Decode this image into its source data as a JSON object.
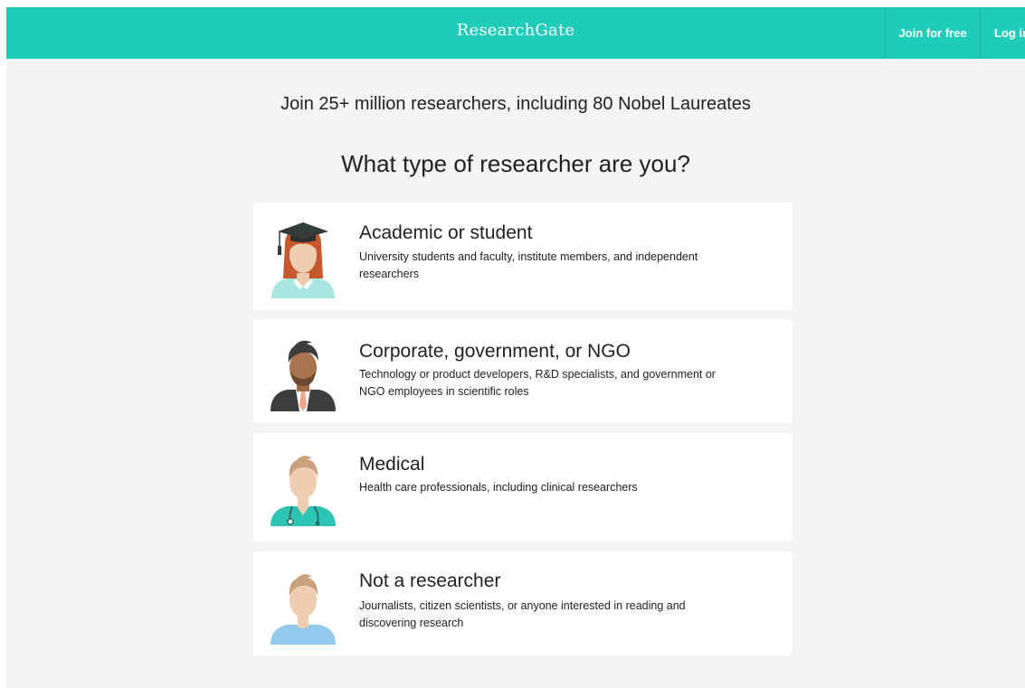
{
  "header": {
    "brand": "ResearchGate",
    "join_label": "Join for free",
    "login_label": "Log in"
  },
  "main": {
    "headline": "Join 25+ million researchers, including 80 Nobel Laureates",
    "question": "What type of researcher are you?",
    "options": [
      {
        "title": "Academic or student",
        "description": "University students and faculty, institute members, and independent researchers",
        "icon": "academic-avatar-icon"
      },
      {
        "title": "Corporate, government, or NGO",
        "description": "Technology or product developers, R&D specialists, and government or NGO employees in scientific roles",
        "icon": "corporate-avatar-icon"
      },
      {
        "title": "Medical",
        "description": "Health care professionals, including clinical researchers",
        "icon": "medical-avatar-icon"
      },
      {
        "title": "Not a researcher",
        "description": "Journalists, citizen scientists, or anyone interested in reading and discovering research",
        "icon": "non-researcher-avatar-icon"
      }
    ]
  },
  "colors": {
    "brand_teal": "#1fcbb9",
    "page_background": "#f4f4f4",
    "card_background": "#ffffff",
    "text": "#222222"
  }
}
